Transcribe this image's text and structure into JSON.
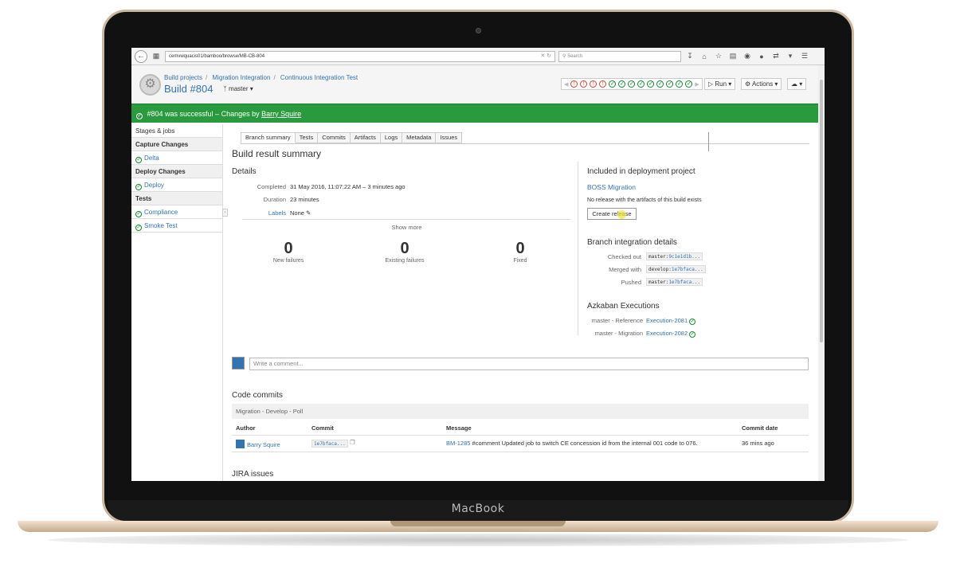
{
  "device": {
    "brand": "MacBook"
  },
  "browser": {
    "url": "cemvwquacis01/bamboo/browse/MB-CB-804",
    "search_placeholder": "Search"
  },
  "header": {
    "breadcrumbs": [
      "Build projects",
      "Migration Integration",
      "Continuous Integration Test"
    ],
    "title": "Build #804",
    "branch": "master",
    "recent_builds": [
      "fail",
      "fail",
      "fail",
      "fail",
      "success",
      "success",
      "success",
      "success",
      "success",
      "success",
      "success",
      "success",
      "success"
    ],
    "run_label": "Run",
    "actions_label": "Actions"
  },
  "banner": {
    "text": "#804 was successful – Changes by ",
    "author": "Barry Squire"
  },
  "sidebar": {
    "items": [
      {
        "label": "Stages & jobs",
        "kind": "plain"
      },
      {
        "label": "Capture Changes",
        "kind": "header"
      },
      {
        "label": "Delta",
        "kind": "job"
      },
      {
        "label": "Deploy Changes",
        "kind": "header"
      },
      {
        "label": "Deploy",
        "kind": "job"
      },
      {
        "label": "Tests",
        "kind": "header"
      },
      {
        "label": "Compliance",
        "kind": "job"
      },
      {
        "label": "Smoke Test",
        "kind": "job"
      }
    ]
  },
  "tabs": [
    "Branch summary",
    "Tests",
    "Commits",
    "Artifacts",
    "Logs",
    "Metadata",
    "Issues"
  ],
  "summary": {
    "heading": "Build result summary",
    "details_heading": "Details",
    "completed_label": "Completed",
    "completed_value": "31 May 2016, 11:07:22 AM – 3 minutes ago",
    "duration_label": "Duration",
    "duration_value": "23 minutes",
    "labels_label": "Labels",
    "labels_value": "None",
    "show_more": "Show more",
    "stats": [
      {
        "value": "0",
        "label": "New failures"
      },
      {
        "value": "0",
        "label": "Existing failures"
      },
      {
        "value": "0",
        "label": "Fixed"
      }
    ]
  },
  "deployment": {
    "heading": "Included in deployment project",
    "project": "BOSS Migration",
    "note": "No release with the artifacts of this build exists",
    "create_release": "Create release"
  },
  "branch_integration": {
    "heading": "Branch integration details",
    "rows": [
      {
        "label": "Checked out",
        "branch": "master",
        "hash": "9c1e1d1b..."
      },
      {
        "label": "Merged with",
        "branch": "develop",
        "hash": "1e7bfaca..."
      },
      {
        "label": "Pushed",
        "branch": "master",
        "hash": "1e7bfaca..."
      }
    ]
  },
  "azkaban": {
    "heading": "Azkaban Executions",
    "rows": [
      {
        "label": "master - Reference",
        "link": "Execution-2081"
      },
      {
        "label": "master - Migration",
        "link": "Execution-2082"
      }
    ]
  },
  "comment": {
    "placeholder": "Write a comment..."
  },
  "code_commits": {
    "heading": "Code commits",
    "repo": "Migration - Develop - Poll",
    "columns": [
      "Author",
      "Commit",
      "Message",
      "Commit date"
    ],
    "rows": [
      {
        "author": "Barry Squire",
        "commit": "1e7bfaca...",
        "issue": "BM-1285",
        "message": " #comment Updated job to switch CE concession id from the internal 001 code to 076.",
        "date": "36 mins ago"
      }
    ]
  },
  "jira": {
    "heading": "JIRA issues"
  }
}
